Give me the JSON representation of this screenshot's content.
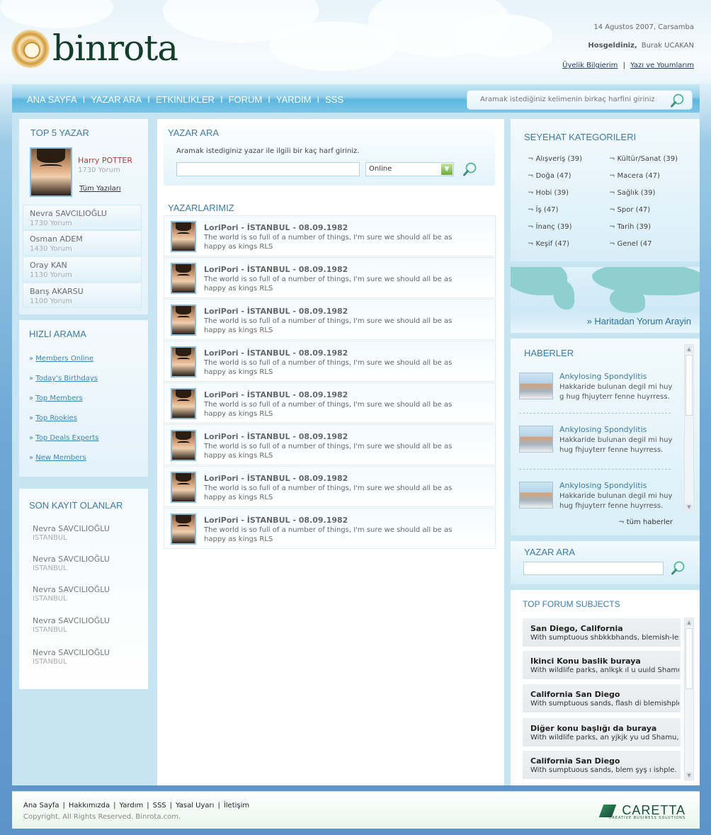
{
  "header": {
    "logo_text": "binrota",
    "date": "14 Agustos 2007, Carsamba",
    "welcome_label": "Hosgeldiniz,",
    "user_name": "Burak UCAKAN",
    "links": [
      "Üyelik Bilgierim",
      "Yazı ve Youmlarım"
    ],
    "link_separator": "|"
  },
  "nav": {
    "items": [
      "ANA SAYFA",
      "YAZAR ARA",
      "ETKINLIKLER",
      "FORUM",
      "YARDIM",
      "SSS"
    ],
    "separator": "I",
    "search_placeholder": "Aramak istediğiniz kelimenin birkaç harfini giriniz"
  },
  "top5": {
    "title": "TOP 5 YAZAR",
    "featured": {
      "name": "Harry POTTER",
      "count": "1730 Yorum",
      "link": "Tüm Yazıları"
    },
    "rows": [
      {
        "name": "Nevra SAVCILIOĞLU",
        "count": "1730 Yorum"
      },
      {
        "name": "Osman ADEM",
        "count": "1430 Yorum"
      },
      {
        "name": "Oray KAN",
        "count": "1130 Yorum"
      },
      {
        "name": "Barış AKARSU",
        "count": "1100 Yorum"
      }
    ]
  },
  "quick": {
    "title": "HIZLI ARAMA",
    "links": [
      "Members Online",
      "Today's Birthdays",
      "Top Members",
      "Top Rookies",
      "Top Deals Experts",
      "New Members"
    ]
  },
  "recent": {
    "title": "SON KAYIT OLANLAR",
    "rows": [
      {
        "name": "Nevra SAVCILIOĞLU",
        "city": "ISTANBUL"
      },
      {
        "name": "Nevra SAVCILIOĞLU",
        "city": "ISTANBUL"
      },
      {
        "name": "Nevra SAVCILIOĞLU",
        "city": "ISTANBUL"
      },
      {
        "name": "Nevra SAVCILIOĞLU",
        "city": "ISTANBUL"
      },
      {
        "name": "Nevra SAVCILIOĞLU",
        "city": "ISTANBUL"
      }
    ]
  },
  "writer_search": {
    "title": "YAZAR ARA",
    "hint": "Aramak istediginiz yazar ile ilgili bir kaç harf giriniz.",
    "select_value": "Online"
  },
  "writers": {
    "title": "YAZARLARIMIZ",
    "rows": [
      {
        "title": "LoriPori - İSTANBUL - 08.09.1982",
        "text": "The world is so full of a number of things, I'm sure we should all be as happy as kings RLS"
      },
      {
        "title": "LoriPori - İSTANBUL - 08.09.1982",
        "text": "The world is so full of a number of things, I'm sure we should all be as happy as kings RLS"
      },
      {
        "title": "LoriPori - İSTANBUL - 08.09.1982",
        "text": "The world is so full of a number of things, I'm sure we should all be as happy as kings RLS"
      },
      {
        "title": "LoriPori - İSTANBUL - 08.09.1982",
        "text": "The world is so full of a number of things, I'm sure we should all be as happy as kings RLS"
      },
      {
        "title": "LoriPori - İSTANBUL - 08.09.1982",
        "text": "The world is so full of a number of things, I'm sure we should all be as happy as kings RLS"
      },
      {
        "title": "LoriPori - İSTANBUL - 08.09.1982",
        "text": "The world is so full of a number of things, I'm sure we should all be as happy as kings RLS"
      },
      {
        "title": "LoriPori - İSTANBUL - 08.09.1982",
        "text": "The world is so full of a number of things, I'm sure we should all be as happy as kings RLS"
      },
      {
        "title": "LoriPori - İSTANBUL - 08.09.1982",
        "text": "The world is so full of a number of things, I'm sure we should all be as happy as kings RLS"
      }
    ]
  },
  "categories": {
    "title": "SEYEHAT KATEGORILERI",
    "items": [
      "¬ Alışveriş  (39)",
      "¬ Kültür/Sanat (39)",
      "¬ Doğa (47)",
      "¬ Macera (47)",
      "¬ Hobi (39)",
      "¬ Sağlık (39)",
      "¬ İş (47)",
      "¬ Spor (47)",
      "¬ İnanç (39)",
      "¬ Tarih (39)",
      "¬ Keşif (47)",
      "¬ Genel (47"
    ]
  },
  "map": {
    "link": "» Haritadan Yorum Arayin"
  },
  "news": {
    "title": "HABERLER",
    "items": [
      {
        "title": "Ankylosing Spondylitis",
        "text": "Hakkaride bulunan degil mi huy g hug fhjuyterr fenne huyrress."
      },
      {
        "title": "Ankylosing Spondylitis",
        "text": "Hakkaride bulunan degil mi huy hug fhjuyterr fenne huyrress."
      },
      {
        "title": "Ankylosing Spondylitis",
        "text": "Hakkaride bulunan degil mi huy hug fhjuyterr fenne huyrress."
      }
    ],
    "all_link": "¬ tüm haberler"
  },
  "writer_search2": {
    "title": "YAZAR ARA"
  },
  "forum": {
    "title": "TOP FORUM SUBJECTS",
    "rows": [
      {
        "title": "San Diego, California",
        "text": "With sumptuous shbkkbhands, blemish-less"
      },
      {
        "title": "Ikinci Konu baslik buraya",
        "text": "With wildlife parks, anlkşk ıl u  uuıld Shamu,"
      },
      {
        "title": "California San Diego",
        "text": "With sumptuous sands, flash di blemishple."
      },
      {
        "title": "Diğer konu başlığı da buraya",
        "text": "With wildlife parks, an yjkjk yu  ud Shamu,"
      },
      {
        "title": "California San Diego",
        "text": "With sumptuous sands, blem şyş ı ishple."
      }
    ]
  },
  "footer": {
    "links": [
      "Ana Sayfa",
      "Hakkımızda",
      "Yardım",
      "SSS",
      "Yasal Uyarı",
      "İletişim"
    ],
    "copyright": "Copyright. All Rights Reserved. Binrota.com.",
    "brand": "CARETTA",
    "brand_sub": "CREATIVE BUSINESS SOLUTIONS"
  },
  "colors": {
    "heading": "#3d7ba6",
    "nav_bar": "#5db7df",
    "page_bg": "#5c94c9",
    "link": "#3e84b2"
  },
  "icons": [
    "search-icon",
    "chevron-down-icon",
    "logo-mark"
  ]
}
